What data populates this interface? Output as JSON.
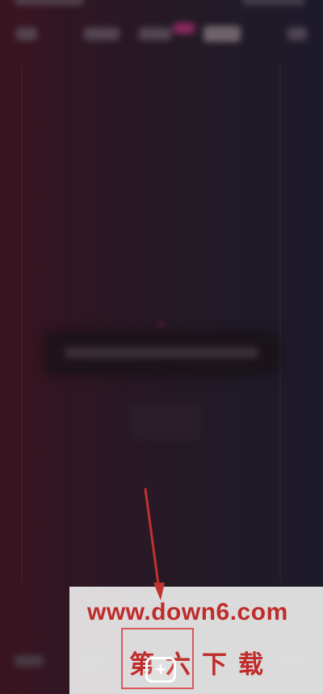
{
  "add_button": {
    "glyph": "+",
    "icon": "plus-square-icon"
  },
  "watermark": {
    "url": "www.down6.com",
    "cn": "第六下载"
  },
  "colors": {
    "arrow": "#c0322d",
    "watermark_text": "#bf2c2a",
    "highlight": "#d9585b"
  }
}
